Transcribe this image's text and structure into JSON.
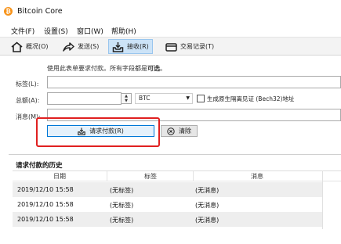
{
  "window": {
    "title": "Bitcoin Core",
    "app_icon_glyph": "₿"
  },
  "menu": {
    "items": [
      "文件(F)",
      "设置(S)",
      "窗口(W)",
      "帮助(H)"
    ]
  },
  "toolbar": {
    "overview": "概况(O)",
    "send": "发送(S)",
    "receive": "接收(R)",
    "transactions": "交易记录(T)"
  },
  "form": {
    "hint_prefix": "使用此表单要求付款。所有字段都是",
    "hint_bold": "可选",
    "hint_suffix": "。",
    "label_label": "标签(L):",
    "amount_label": "总额(A):",
    "message_label": "消息(M):",
    "label_value": "",
    "amount_value": "",
    "message_value": "",
    "unit": "BTC",
    "bech32_checkbox": "生成原生隔离见证 (Bech32)地址",
    "bech32_checked": false,
    "request_button": "请求付款(R)",
    "clear_button": "清除"
  },
  "history": {
    "title": "请求付款的历史",
    "columns": [
      "日期",
      "标签",
      "消息"
    ],
    "rows": [
      {
        "date": "2019/12/10 15:58",
        "label": "(无标签)",
        "message": "(无消息)"
      },
      {
        "date": "2019/12/10 15:58",
        "label": "(无标签)",
        "message": "(无消息)"
      },
      {
        "date": "2019/12/10 15:58",
        "label": "(无标签)",
        "message": "(无消息)"
      }
    ]
  },
  "colors": {
    "accent": "#0078d7",
    "highlight": "#e02020",
    "brand": "#f7931a"
  }
}
